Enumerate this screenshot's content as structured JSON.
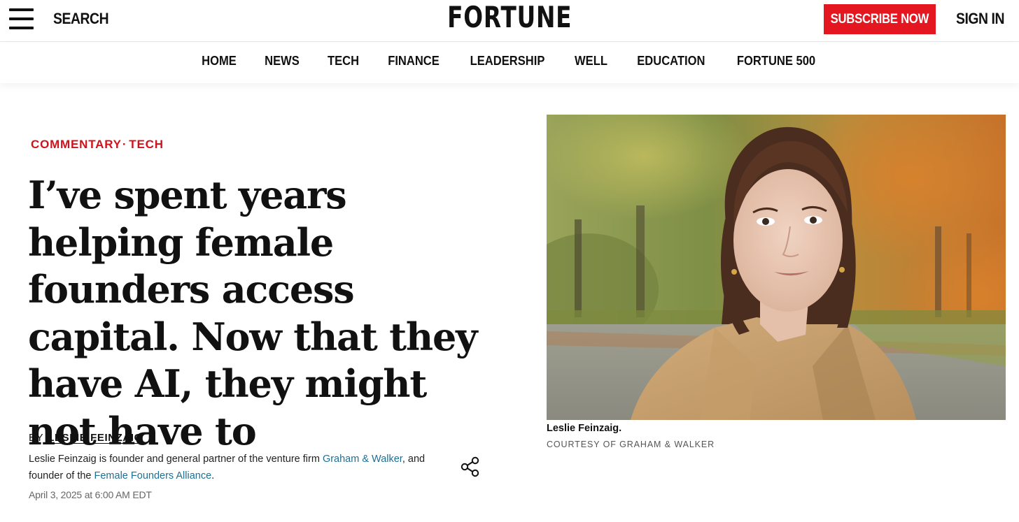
{
  "header": {
    "menu_icon": "hamburger-menu-icon",
    "search_label": "SEARCH",
    "logo_text": "FORTUNE",
    "subscribe_label": "SUBSCRIBE NOW",
    "signin_label": "SIGN IN",
    "accent_color": "#e4161f"
  },
  "nav": {
    "items": [
      {
        "label": "HOME"
      },
      {
        "label": "NEWS"
      },
      {
        "label": "TECH"
      },
      {
        "label": "FINANCE"
      },
      {
        "label": "LEADERSHIP"
      },
      {
        "label": "WELL"
      },
      {
        "label": "EDUCATION"
      },
      {
        "label": "FORTUNE 500"
      }
    ]
  },
  "article": {
    "kicker": {
      "section1": "COMMENTARY",
      "separator": "·",
      "section2": "TECH"
    },
    "headline": "I’ve spent years helping female founders access capital. Now that they have AI, they might not have to",
    "byline_prefix": "BY",
    "author": "LESLIE FEINZAIG",
    "bio": {
      "part1": "Leslie Feinzaig is founder and general partner of the venture firm ",
      "link1": "Graham & Walker",
      "part2": ", and founder of the ",
      "link2": "Female Founders Alliance",
      "part3": "."
    },
    "date": "April 3, 2025 at 6:00 AM EDT",
    "share_icon": "share-icon",
    "link_color": "#1f6f93"
  },
  "photo": {
    "caption": "Leslie Feinzaig.",
    "credit": "COURTESY OF GRAHAM & WALKER"
  }
}
